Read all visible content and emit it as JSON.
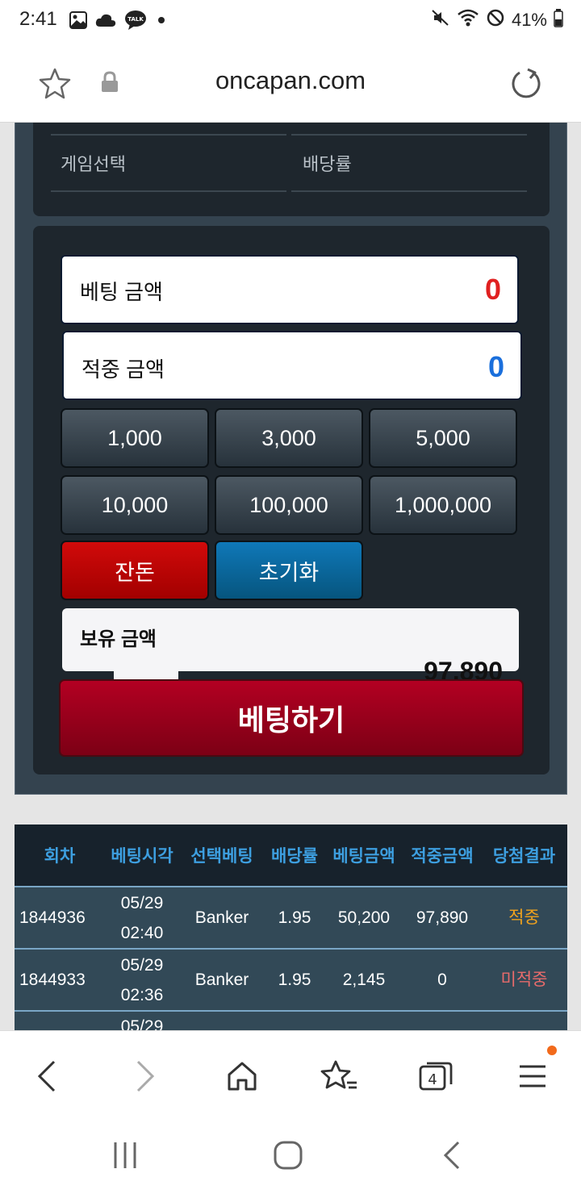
{
  "status_bar": {
    "time": "2:41",
    "battery": "41%",
    "icons": [
      "gallery-icon",
      "cloud-icon",
      "talk-icon",
      "dot-icon",
      "mute-icon",
      "wifi-icon",
      "no-disturb-icon",
      "battery-icon"
    ],
    "talk_label": "TALK"
  },
  "browser": {
    "url": "oncapan.com",
    "tab_count": "4"
  },
  "game_info": {
    "game_select_label": "게임선택",
    "odds_label": "배당률"
  },
  "bet_panel": {
    "bet_amount_label": "베팅 금액",
    "bet_amount_value": "0",
    "win_amount_label": "적중 금액",
    "win_amount_value": "0",
    "chips": [
      "1,000",
      "3,000",
      "5,000",
      "10,000",
      "100,000",
      "1,000,000"
    ],
    "balance_button": "잔돈",
    "reset_button": "초기화",
    "holdings_label": "보유 금액",
    "holdings_value": "97,890",
    "bet_button": "베팅하기",
    "colors": {
      "bet_value": "#e02020",
      "win_value": "#1a6fdc",
      "accent_red": "#a8001e"
    }
  },
  "history_table": {
    "headers": [
      "회차",
      "베팅시각",
      "선택베팅",
      "배당률",
      "베팅금액",
      "적중금액",
      "당첨결과"
    ],
    "rows": [
      {
        "round": "1844936",
        "date": "05/29",
        "time": "02:40",
        "pick": "Banker",
        "odds": "1.95",
        "bet": "50,200",
        "win": "97,890",
        "result": "적중"
      },
      {
        "round": "1844933",
        "date": "05/29",
        "time": "02:36",
        "pick": "Banker",
        "odds": "1.95",
        "bet": "2,145",
        "win": "0",
        "result": "미적중"
      },
      {
        "round": "",
        "date": "05/29",
        "time": "",
        "pick": "",
        "odds": "",
        "bet": "",
        "win": "",
        "result": ""
      }
    ]
  }
}
